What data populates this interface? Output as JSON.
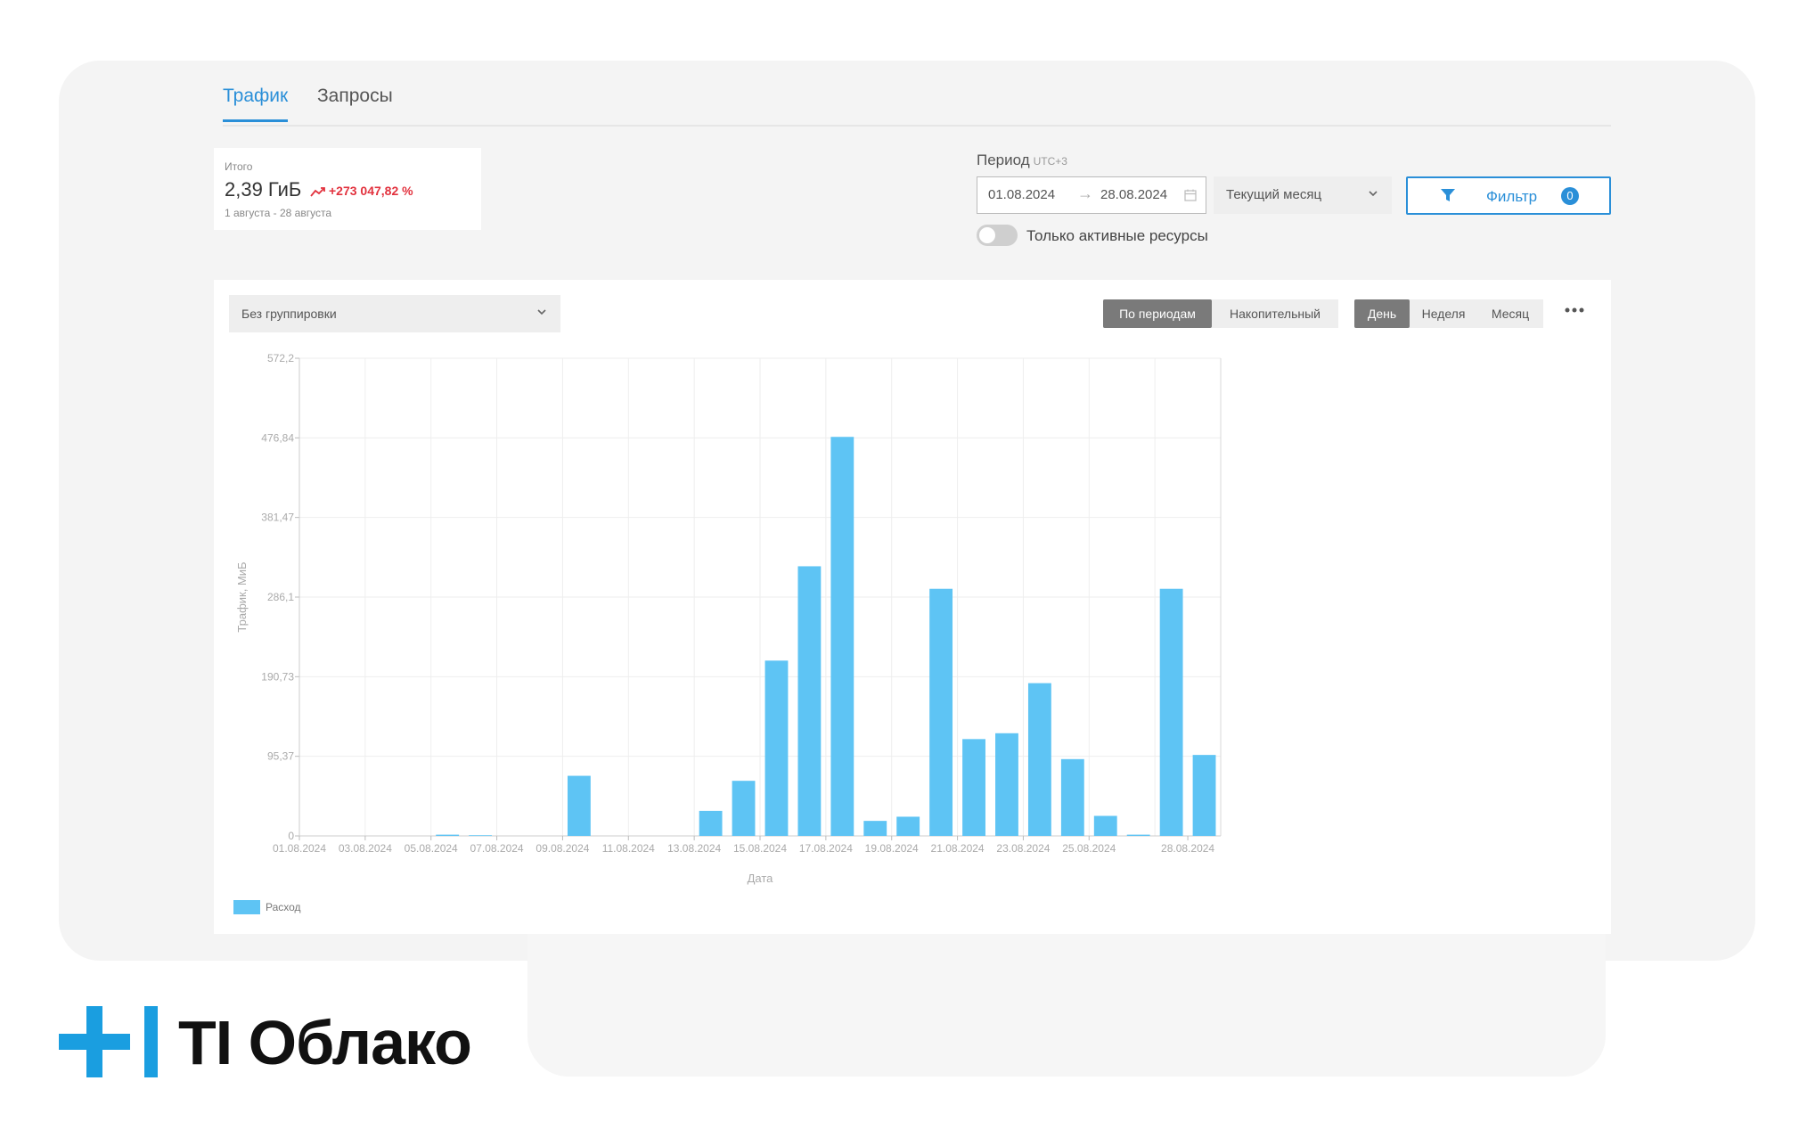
{
  "tabs": [
    {
      "label": "Трафик",
      "active": true
    },
    {
      "label": "Запросы",
      "active": false
    }
  ],
  "summary": {
    "label": "Итого",
    "value": "2,39 ГиБ",
    "delta": "+273 047,82 %",
    "range": "1 августа - 28 августа"
  },
  "period": {
    "label": "Период",
    "timezone": "UTC+3",
    "from": "01.08.2024",
    "to": "28.08.2024",
    "preset": "Текущий месяц"
  },
  "filter": {
    "label": "Фильтр",
    "count": "0"
  },
  "active_only": {
    "label": "Только активные ресурсы",
    "on": false
  },
  "grouping": {
    "label": "Без группировки"
  },
  "mode": {
    "options": [
      "По периодам",
      "Накопительный"
    ],
    "selected": "По периодам"
  },
  "granularity": {
    "options": [
      "День",
      "Неделя",
      "Месяц"
    ],
    "selected": "День"
  },
  "colors": {
    "accent": "#2a8fd8",
    "bar": "#5ec4f4",
    "delta": "#e2323e"
  },
  "icons": {
    "more": "more-dots-icon",
    "filter": "filter-icon",
    "calendar": "calendar-icon",
    "trend": "trend-up-icon"
  },
  "brand": {
    "name": "TI Облако"
  },
  "chart_data": {
    "type": "bar",
    "xlabel": "Дата",
    "ylabel": "Трафик, МиБ",
    "ylim": [
      0,
      572.2
    ],
    "yticks": [
      "0",
      "95,37",
      "190,73",
      "286,1",
      "381,47",
      "476,84",
      "572,2"
    ],
    "ytick_values": [
      0,
      95.37,
      190.73,
      286.1,
      381.47,
      476.84,
      572.2
    ],
    "xtick_labels": [
      "01.08.2024",
      "03.08.2024",
      "05.08.2024",
      "07.08.2024",
      "09.08.2024",
      "11.08.2024",
      "13.08.2024",
      "15.08.2024",
      "17.08.2024",
      "19.08.2024",
      "21.08.2024",
      "23.08.2024",
      "25.08.2024",
      "28.08.2024"
    ],
    "categories": [
      "01.08.2024",
      "02.08.2024",
      "03.08.2024",
      "04.08.2024",
      "05.08.2024",
      "06.08.2024",
      "07.08.2024",
      "08.08.2024",
      "09.08.2024",
      "10.08.2024",
      "11.08.2024",
      "12.08.2024",
      "13.08.2024",
      "14.08.2024",
      "15.08.2024",
      "16.08.2024",
      "17.08.2024",
      "18.08.2024",
      "19.08.2024",
      "20.08.2024",
      "21.08.2024",
      "22.08.2024",
      "23.08.2024",
      "24.08.2024",
      "25.08.2024",
      "26.08.2024",
      "27.08.2024",
      "28.08.2024"
    ],
    "series": [
      {
        "name": "Расход",
        "values": [
          0,
          0,
          0,
          0,
          1.5,
          0.8,
          0,
          0,
          72,
          0,
          0,
          0,
          30,
          66,
          210,
          323,
          478,
          18,
          23,
          296,
          116,
          123,
          183,
          92,
          24,
          1.5,
          296,
          97
        ]
      }
    ],
    "grid": true,
    "legend": "bottom-left"
  }
}
